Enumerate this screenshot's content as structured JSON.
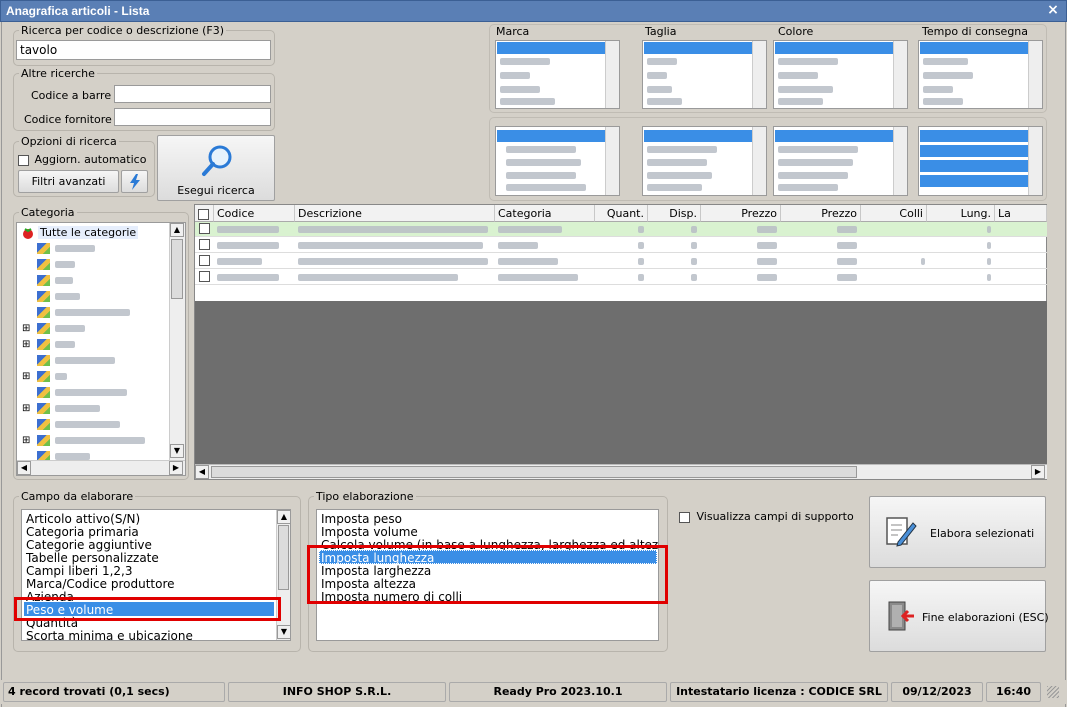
{
  "window": {
    "title": "Anagrafica articoli  - Lista",
    "close": "×"
  },
  "search": {
    "legend": "Ricerca per codice o descrizione (F3)",
    "value": "tavolo"
  },
  "altre": {
    "legend": "Altre ricerche",
    "barcode_label": "Codice a barre :",
    "barcode_value": "",
    "supplier_label": "Codice fornitore :",
    "supplier_value": ""
  },
  "opzioni": {
    "legend": "Opzioni di ricerca",
    "auto_label": "Aggiorn. automatico",
    "filters_label": "Filtri avanzati"
  },
  "search_button": {
    "label": "Esegui ricerca"
  },
  "filters": {
    "marca": "Marca",
    "taglia": "Taglia",
    "colore": "Colore",
    "tempo": "Tempo di consegna"
  },
  "categoria": {
    "legend": "Categoria",
    "root": "Tutte le categorie"
  },
  "grid": {
    "columns": [
      "Codice",
      "Descrizione",
      "Categoria",
      "Quant.",
      "Disp.",
      "Prezzo",
      "Prezzo",
      "Colli",
      "Lung.",
      "La"
    ]
  },
  "campo": {
    "legend": "Campo da elaborare",
    "items": [
      "Articolo attivo(S/N)",
      "Categoria primaria",
      "Categorie aggiuntive",
      "Tabelle personalizzate",
      "Campi liberi 1,2,3",
      "Marca/Codice produttore",
      "Azienda",
      "Peso e volume",
      "Quantità",
      "Scorta minima e ubicazione"
    ],
    "selected": "Peso e volume"
  },
  "tipo": {
    "legend": "Tipo elaborazione",
    "items": [
      "Imposta peso",
      "Imposta volume",
      "Calcola volume (in base a lunghezza, larghezza ed altezza)",
      "Imposta lunghezza",
      "Imposta larghezza",
      "Imposta altezza",
      "Imposta numero di colli"
    ],
    "selected": "Imposta lunghezza"
  },
  "support": {
    "label": "Visualizza campi di supporto"
  },
  "actions": {
    "elabora": "Elabora selezionati",
    "fine": "Fine elaborazioni (ESC)"
  },
  "status": {
    "records": "4 record trovati (0,1 secs)",
    "company": "INFO SHOP S.R.L.",
    "product": "Ready Pro 2023.10.1",
    "license": "Intestatario licenza : CODICE SRL",
    "date": "09/12/2023",
    "time": "16:40"
  },
  "colors": {
    "title_bar": "#5a7fb5",
    "selection": "#3a8ee6",
    "highlight_border": "#e00000",
    "grid_first_row": "#d9f2d0"
  }
}
